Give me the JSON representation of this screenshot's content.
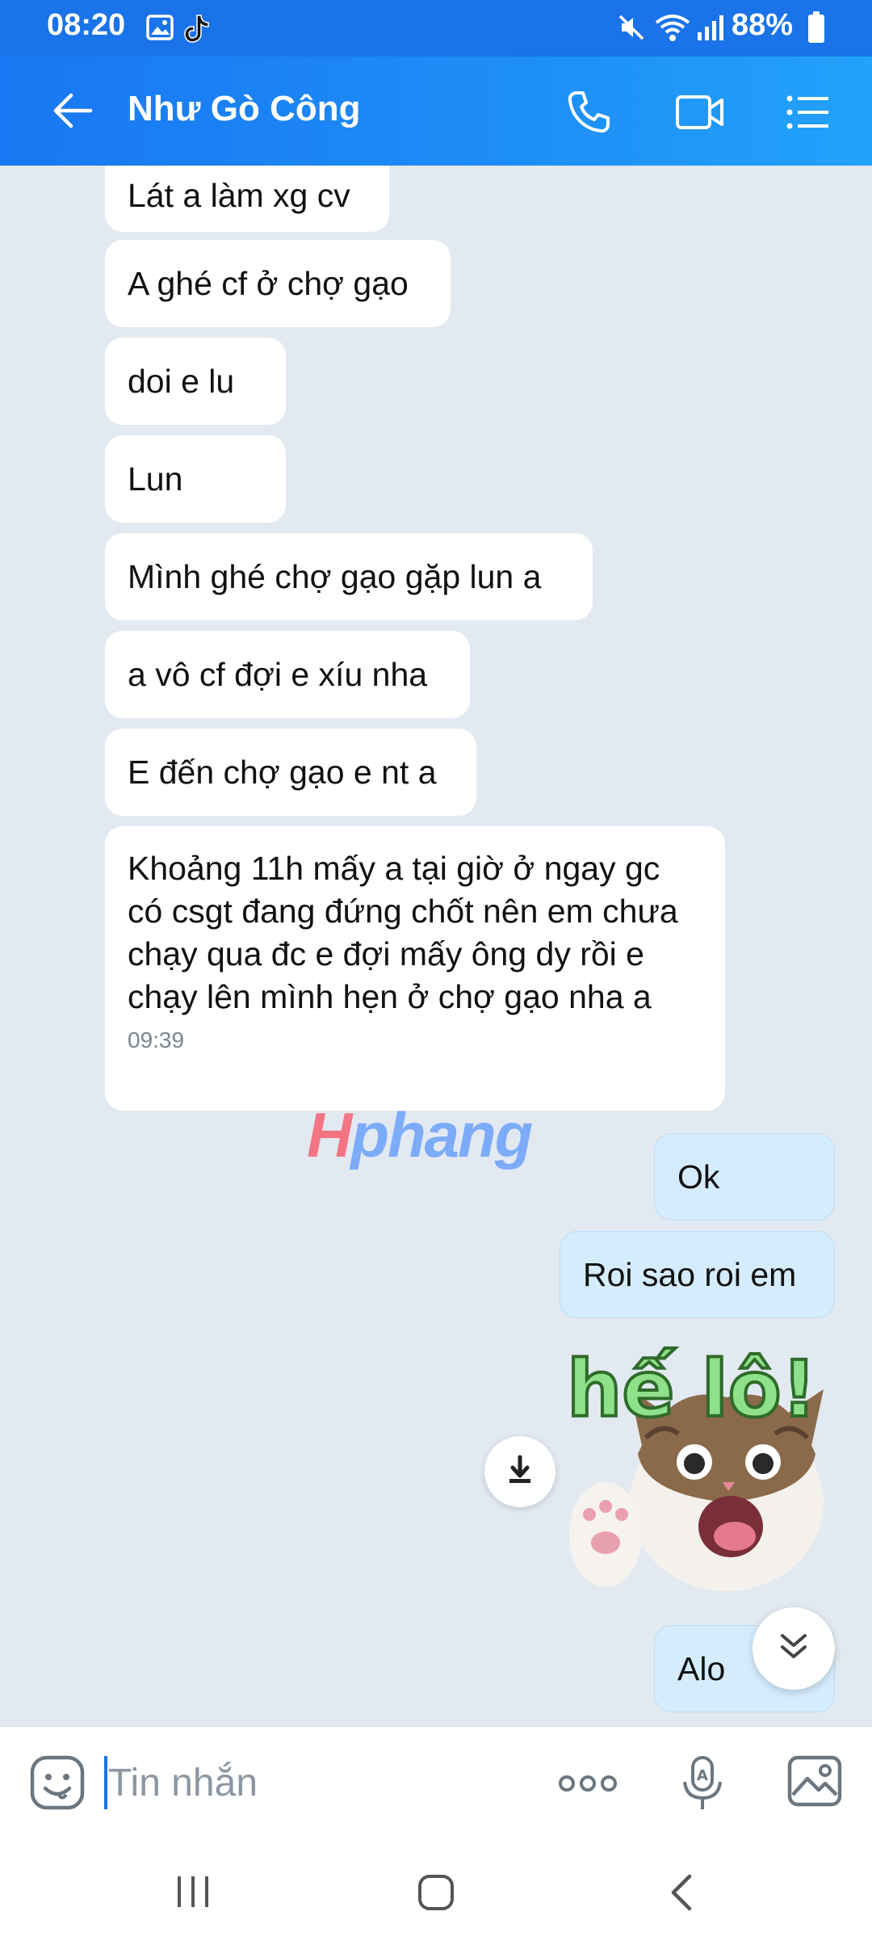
{
  "status_bar": {
    "time": "08:20",
    "battery": "88%",
    "icons": [
      "gallery-icon",
      "tiktok-icon",
      "mute-icon",
      "wifi-icon",
      "signal-icon",
      "battery-icon"
    ]
  },
  "header": {
    "title": "Như Gò Công",
    "icons": [
      "back-arrow-icon",
      "phone-icon",
      "video-call-icon",
      "menu-list-icon"
    ]
  },
  "messages": [
    {
      "sender": "other",
      "text": "Lát a làm xg cv"
    },
    {
      "sender": "other",
      "text": "A ghé cf ở chợ gạo"
    },
    {
      "sender": "other",
      "text": "doi e lu"
    },
    {
      "sender": "other",
      "text": "Lun"
    },
    {
      "sender": "other",
      "text": "Mình ghé chợ gạo gặp lun a"
    },
    {
      "sender": "other",
      "text": "a vô cf đợi e xíu nha"
    },
    {
      "sender": "other",
      "text": "E đến chợ gạo e nt a"
    },
    {
      "sender": "other",
      "text": "Khoảng 11h mấy a tại giờ ở ngay gc có csgt đang đứng chốt nên em chưa chạy qua đc e đợi mấy ông dy rồi e chạy lên mình hẹn ở chợ gạo nha a",
      "time": "09:39"
    },
    {
      "sender": "me",
      "text": "Ok"
    },
    {
      "sender": "me",
      "text": "Roi sao roi em"
    },
    {
      "sender": "me",
      "type": "sticker",
      "sticker_text": "hế lô!"
    },
    {
      "sender": "me",
      "text": "Alo"
    }
  ],
  "watermark": {
    "prefix": "H",
    "rest": "phang"
  },
  "input": {
    "placeholder": "Tin nhắn"
  },
  "colors": {
    "accent": "#1a73e8",
    "chat_bg": "#e2e9f1",
    "my_bubble": "#d4ecfd"
  }
}
